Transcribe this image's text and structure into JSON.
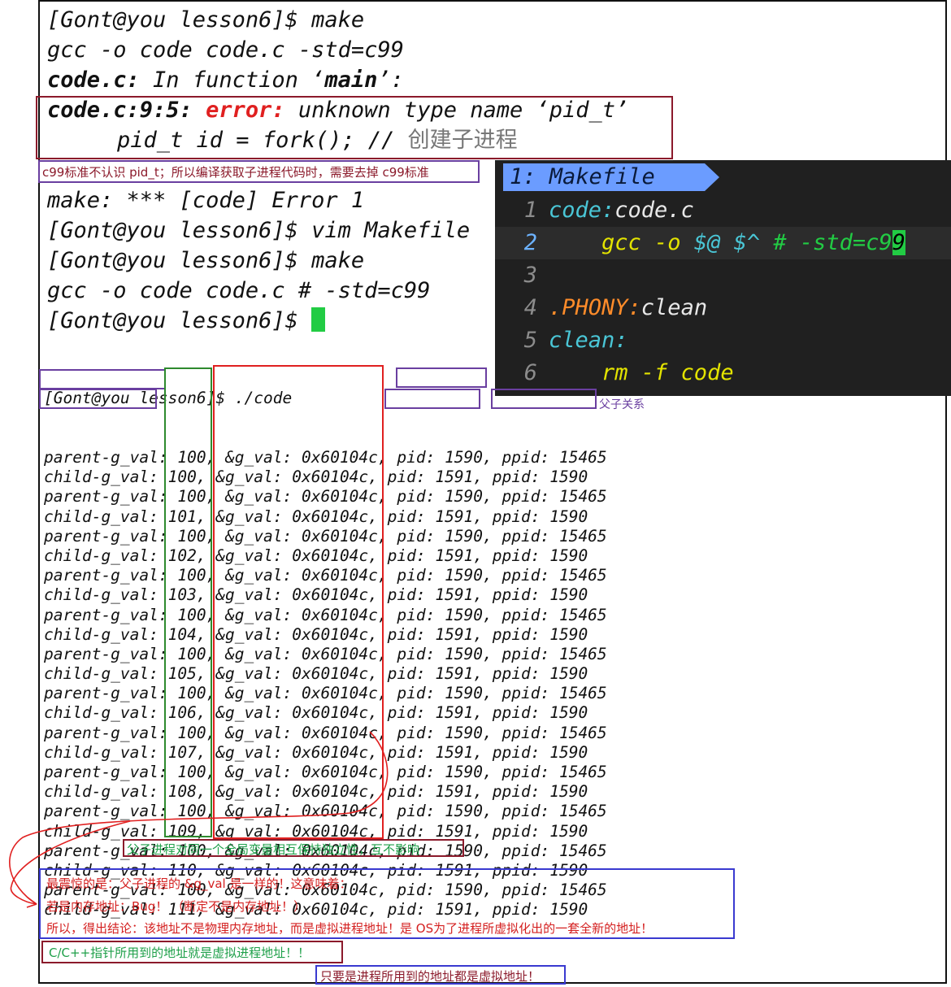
{
  "terminal": {
    "lines": [
      "[Gont@you lesson6]$ make",
      "gcc -o code code.c -std=c99",
      "code.c: In function ‘main’:",
      "code.c:9:5:",
      "error:",
      "unknown type name ‘pid_t’",
      "pid_t id = fork(); //",
      "创建子进程",
      "make: *** [code] Error 1",
      "[Gont@you lesson6]$ vim Makefile",
      "[Gont@you lesson6]$ make",
      "gcc -o code code.c # -std=c99",
      "[Gont@you lesson6]$"
    ],
    "code_c_label": "code.c:",
    "in_function": " In function ‘",
    "main": "main",
    "close_quote": "’:"
  },
  "notes": {
    "c99": "c99标准不认识 pid_t；所以编译获取子进程代码时，需要去掉 c99标准",
    "parent_child": "父子关系",
    "independent": "父子进程对同一个全局变量相互保持独立性，互不影响",
    "shock1": "最震惊的是：父子进程的 &g_val 是一样的！这意味着：",
    "shock2": "若是内存地址：Bug！ （断定不是内存地址！）",
    "shock3": "所以，得出结论：该地址不是物理内存地址，而是虚拟进程地址！是 OS为了进程所虚拟化出的一套全新的地址！",
    "pointer": "C/C++指针所用到的地址就是虚拟进程地址！！",
    "virtual": "只要是进程所用到的地址都是虚拟地址！"
  },
  "vim": {
    "tab": "1: Makefile",
    "lines": [
      {
        "num": "1",
        "parts": [
          "code:",
          "code.c"
        ]
      },
      {
        "num": "2",
        "parts": [
          "    gcc -o ",
          "$@",
          " ",
          "$^",
          " # -std=c9",
          "9"
        ]
      },
      {
        "num": "3",
        "parts": []
      },
      {
        "num": "4",
        "parts": [
          ".PHONY:",
          "clean"
        ]
      },
      {
        "num": "5",
        "parts": [
          "clean:"
        ]
      },
      {
        "num": "6",
        "parts": [
          "    rm -f code"
        ]
      }
    ]
  },
  "output": {
    "command": "[Gont@you lesson6]$ ./code",
    "rows": [
      "parent-g_val: 100, &g_val: 0x60104c, pid: 1590, ppid: 15465",
      "child-g_val: 100, &g_val: 0x60104c, pid: 1591, ppid: 1590",
      "parent-g_val: 100, &g_val: 0x60104c, pid: 1590, ppid: 15465",
      "child-g_val: 101, &g_val: 0x60104c, pid: 1591, ppid: 1590",
      "parent-g_val: 100, &g_val: 0x60104c, pid: 1590, ppid: 15465",
      "child-g_val: 102, &g_val: 0x60104c, pid: 1591, ppid: 1590",
      "parent-g_val: 100, &g_val: 0x60104c, pid: 1590, ppid: 15465",
      "child-g_val: 103, &g_val: 0x60104c, pid: 1591, ppid: 1590",
      "parent-g_val: 100, &g_val: 0x60104c, pid: 1590, ppid: 15465",
      "child-g_val: 104, &g_val: 0x60104c, pid: 1591, ppid: 1590",
      "parent-g_val: 100, &g_val: 0x60104c, pid: 1590, ppid: 15465",
      "child-g_val: 105, &g_val: 0x60104c, pid: 1591, ppid: 1590",
      "parent-g_val: 100, &g_val: 0x60104c, pid: 1590, ppid: 15465",
      "child-g_val: 106, &g_val: 0x60104c, pid: 1591, ppid: 1590",
      "parent-g_val: 100, &g_val: 0x60104c, pid: 1590, ppid: 15465",
      "child-g_val: 107, &g_val: 0x60104c, pid: 1591, ppid: 1590",
      "parent-g_val: 100, &g_val: 0x60104c, pid: 1590, ppid: 15465",
      "child-g_val: 108, &g_val: 0x60104c, pid: 1591, ppid: 1590",
      "parent-g_val: 100, &g_val: 0x60104c, pid: 1590, ppid: 15465",
      "child-g_val: 109, &g_val: 0x60104c, pid: 1591, ppid: 1590",
      "parent-g_val: 100, &g_val: 0x60104c, pid: 1590, ppid: 15465",
      "child-g_val: 110, &g_val: 0x60104c, pid: 1591, ppid: 1590",
      "parent-g_val: 100, &g_val: 0x60104c, pid: 1590, ppid: 15465",
      "child-g_val: 111, &g_val: 0x60104c, pid: 1591, ppid: 1590"
    ]
  },
  "colors": {
    "dark_red": "#8b1a2b",
    "purple": "#6a3fa0",
    "blue": "#3a3ad0",
    "green": "#2e8a2e",
    "red": "#e02020",
    "note_red": "#d42020",
    "note_green": "#1fa04a"
  }
}
